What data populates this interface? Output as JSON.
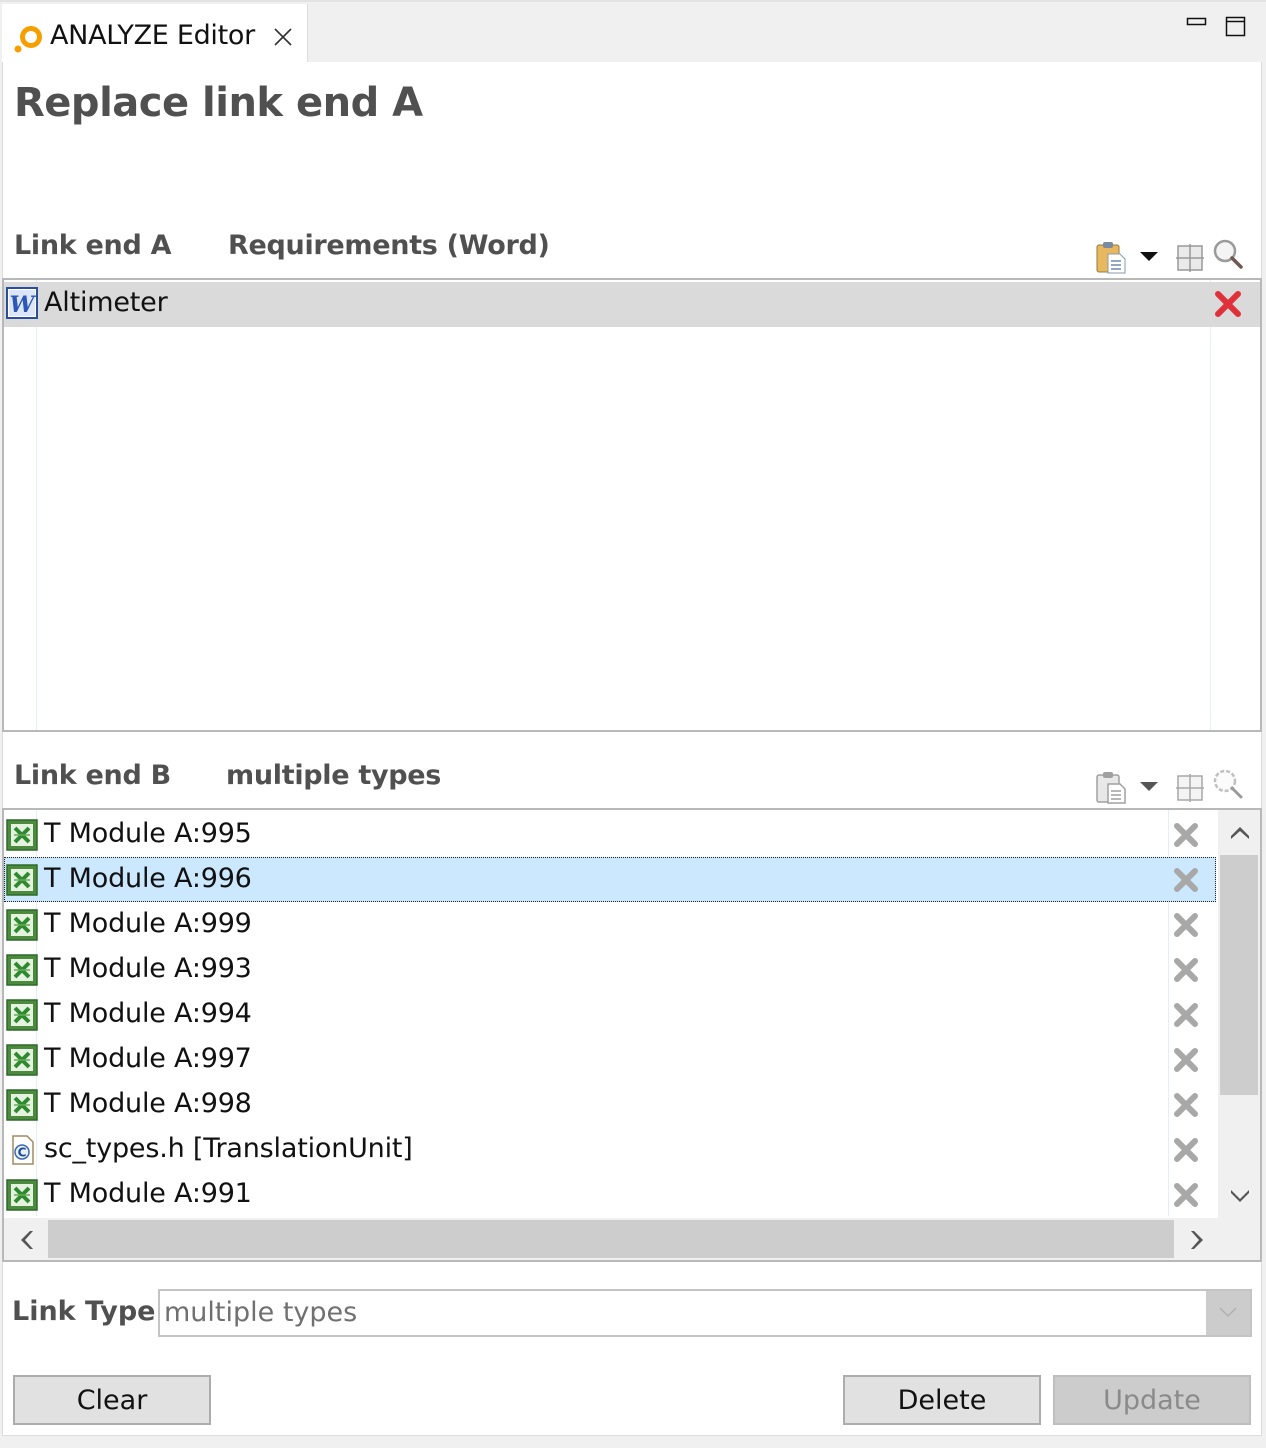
{
  "window": {
    "tab_title": "ANALYZE Editor",
    "tab_icon": "analyze-icon",
    "controls": [
      "minimize-icon",
      "maximize-icon"
    ]
  },
  "page": {
    "title": "Replace link end A"
  },
  "link_end_a": {
    "label": "Link end A",
    "type": "Requirements (Word)",
    "toolbar": [
      {
        "name": "paste-icon",
        "enabled": true
      },
      {
        "name": "dropdown-arrow-icon",
        "enabled": true
      },
      {
        "name": "grid-icon",
        "enabled": true
      },
      {
        "name": "search-icon",
        "enabled": true
      }
    ],
    "items": [
      {
        "icon": "word-document-icon",
        "label": "Altimeter",
        "remove_icon": "remove-icon",
        "selected": true
      }
    ]
  },
  "link_end_b": {
    "label": "Link end B",
    "type": "multiple types",
    "toolbar": [
      {
        "name": "paste-icon",
        "enabled": false
      },
      {
        "name": "dropdown-arrow-icon",
        "enabled": false
      },
      {
        "name": "grid-icon",
        "enabled": false
      },
      {
        "name": "search-icon",
        "enabled": false
      }
    ],
    "items": [
      {
        "icon": "excel-icon",
        "label": "T Module A:995",
        "selected": false
      },
      {
        "icon": "excel-icon",
        "label": "T Module A:996",
        "selected": true
      },
      {
        "icon": "excel-icon",
        "label": "T Module A:999",
        "selected": false
      },
      {
        "icon": "excel-icon",
        "label": "T Module A:993",
        "selected": false
      },
      {
        "icon": "excel-icon",
        "label": "T Module A:994",
        "selected": false
      },
      {
        "icon": "excel-icon",
        "label": "T Module A:997",
        "selected": false
      },
      {
        "icon": "excel-icon",
        "label": "T Module A:998",
        "selected": false
      },
      {
        "icon": "c-source-file-icon",
        "label": "sc_types.h [TranslationUnit]",
        "selected": false
      },
      {
        "icon": "excel-icon",
        "label": "T Module A:991",
        "selected": false
      }
    ]
  },
  "link_type": {
    "label": "Link Type",
    "value": "multiple types"
  },
  "buttons": {
    "clear": "Clear",
    "delete": "Delete",
    "update": "Update"
  },
  "colors": {
    "selection": "#cce8ff",
    "remove_active": "#e0303a",
    "remove_disabled": "#a8a8a8",
    "heading": "#505050"
  }
}
